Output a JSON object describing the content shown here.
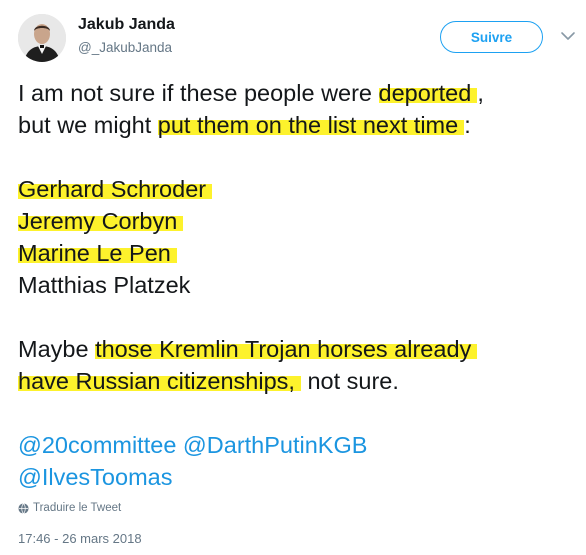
{
  "author": {
    "display_name": "Jakub Janda",
    "handle": "@_JakubJanda"
  },
  "follow_button": {
    "label": "Suivre"
  },
  "tweet": {
    "line1": {
      "a": "I am not sure if these people were ",
      "b": "deported",
      "c": ","
    },
    "line2": {
      "a": "but we might ",
      "b": "put them on the list next time",
      "c": ":"
    },
    "names": [
      "Gerhard Schroder",
      "Jeremy Corbyn",
      "Marine Le Pen",
      "Matthias Platzek"
    ],
    "line3": {
      "a": "Maybe ",
      "b": "those Kremlin Trojan horses already"
    },
    "line4": {
      "a": "have Russian citizenships,",
      "b": " not sure."
    },
    "mentions": [
      "@20committee",
      "@DarthPutinKGB",
      "@IlvesToomas"
    ]
  },
  "translate": {
    "label": "Traduire le Tweet",
    "icon": "globe-icon"
  },
  "timestamp": "17:46 - 26 mars 2018",
  "colors": {
    "highlight": "#fdf22c",
    "link": "#1b95e0",
    "follow": "#1da1f2",
    "meta": "#657786"
  }
}
